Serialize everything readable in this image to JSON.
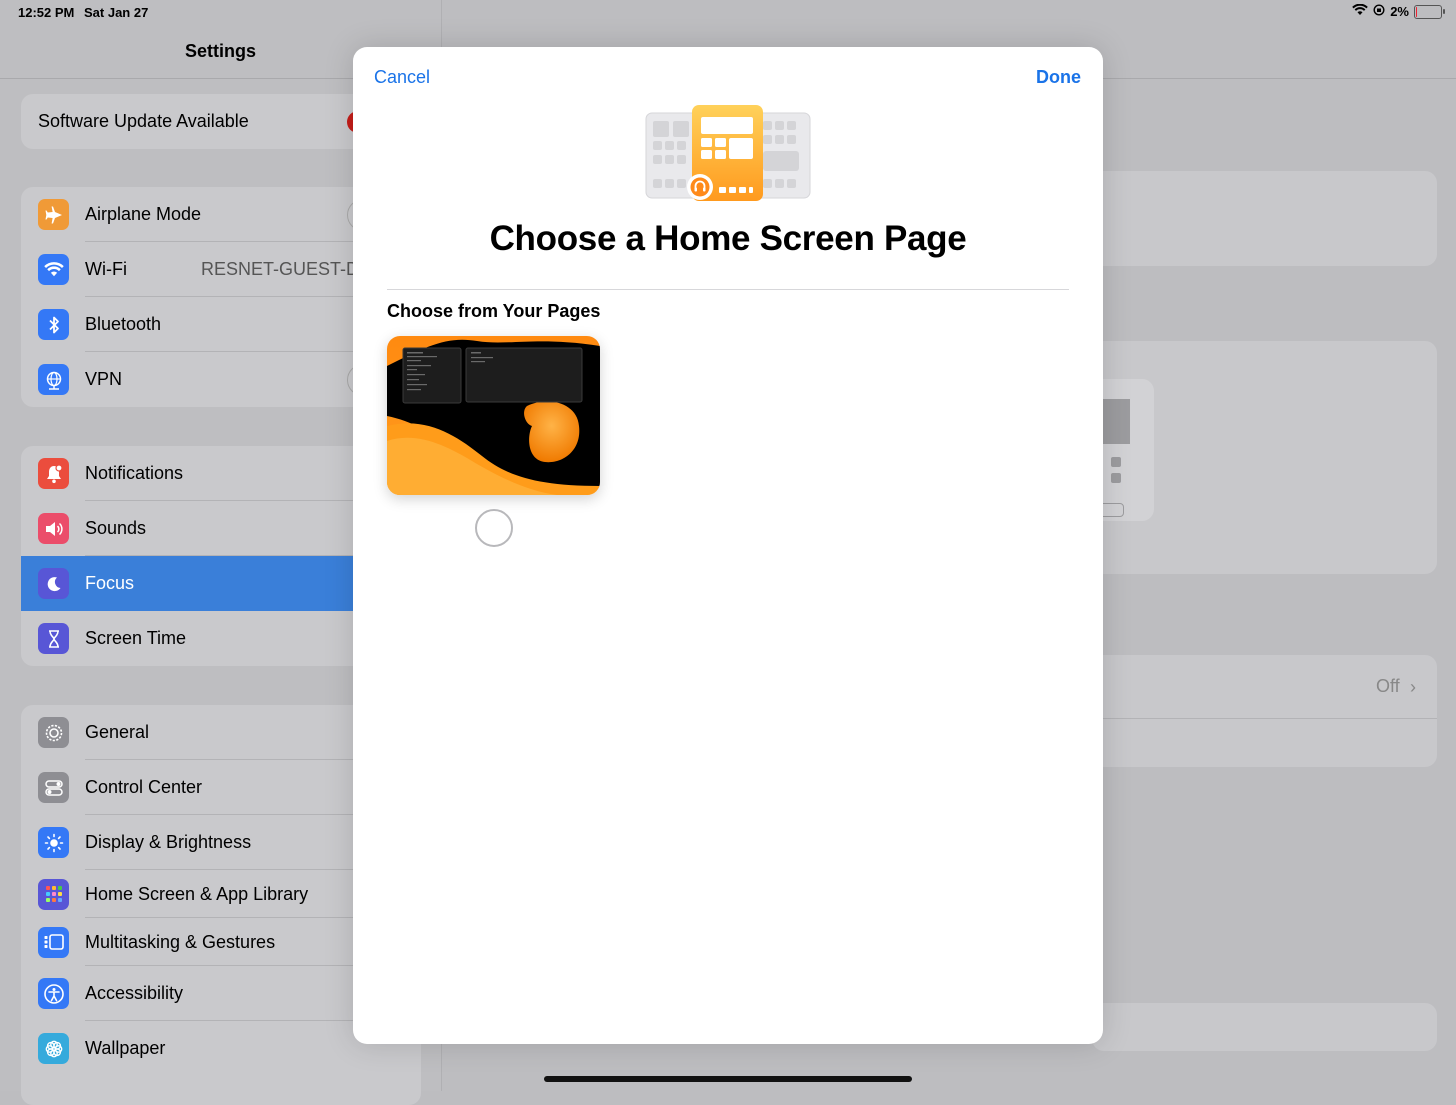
{
  "status_bar": {
    "time": "12:52 PM",
    "date": "Sat Jan 27",
    "battery": "2%",
    "battery_level": 0.02
  },
  "sidebar": {
    "title": "Settings",
    "software_update": "Software Update Available",
    "group1": [
      {
        "label": "Airplane Mode",
        "icon": "airplane-icon",
        "color": "#f09a37"
      },
      {
        "label": "Wi-Fi",
        "value": "RESNET-GUEST-D",
        "icon": "wifi-icon",
        "color": "#3478f6"
      },
      {
        "label": "Bluetooth",
        "icon": "bluetooth-icon",
        "color": "#3478f6"
      },
      {
        "label": "VPN",
        "icon": "vpn-globe-icon",
        "color": "#3478f6"
      }
    ],
    "group2": [
      {
        "label": "Notifications",
        "icon": "bell-icon",
        "color": "#eb4d3d"
      },
      {
        "label": "Sounds",
        "icon": "speaker-icon",
        "color": "#eb4d6a"
      },
      {
        "label": "Focus",
        "icon": "moon-icon",
        "color": "#5856d6",
        "selected": true
      },
      {
        "label": "Screen Time",
        "icon": "hourglass-icon",
        "color": "#5856d6"
      }
    ],
    "group3": [
      {
        "label": "General",
        "icon": "gear-icon",
        "color": "#8e8e93"
      },
      {
        "label": "Control Center",
        "icon": "switches-icon",
        "color": "#8e8e93"
      },
      {
        "label": "Display & Brightness",
        "icon": "sun-icon",
        "color": "#3478f6"
      },
      {
        "label": "Home Screen & App Library",
        "icon": "app-grid-icon",
        "color": "#5856d6"
      },
      {
        "label": "Multitasking & Gestures",
        "icon": "multitask-icon",
        "color": "#3478f6"
      },
      {
        "label": "Accessibility",
        "icon": "accessibility-icon",
        "color": "#3478f6"
      },
      {
        "label": "Wallpaper",
        "icon": "flower-icon",
        "color": "#35aadc"
      }
    ]
  },
  "detail": {
    "off_label": "Off"
  },
  "modal": {
    "cancel": "Cancel",
    "done": "Done",
    "title": "Choose a Home Screen Page",
    "section_label": "Choose from Your Pages"
  },
  "colors": {
    "accent": "#1a73e8",
    "selected_row": "#3a7fd9"
  }
}
